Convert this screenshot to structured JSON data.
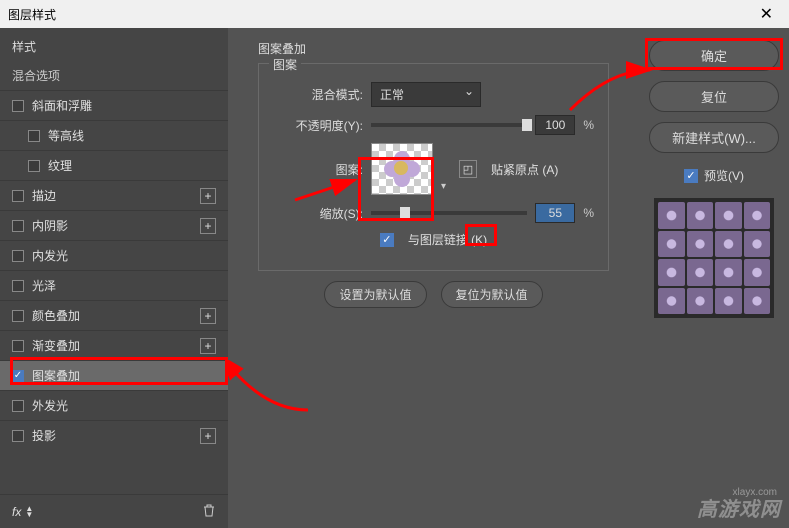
{
  "window": {
    "title": "图层样式",
    "close": "✕"
  },
  "sidebar": {
    "header": "样式",
    "blend_options": "混合选项",
    "items": [
      {
        "label": "斜面和浮雕",
        "checked": false,
        "plus": false,
        "indent": false
      },
      {
        "label": "等高线",
        "checked": false,
        "plus": false,
        "indent": true
      },
      {
        "label": "纹理",
        "checked": false,
        "plus": false,
        "indent": true
      },
      {
        "label": "描边",
        "checked": false,
        "plus": true,
        "indent": false
      },
      {
        "label": "内阴影",
        "checked": false,
        "plus": true,
        "indent": false
      },
      {
        "label": "内发光",
        "checked": false,
        "plus": false,
        "indent": false
      },
      {
        "label": "光泽",
        "checked": false,
        "plus": false,
        "indent": false
      },
      {
        "label": "颜色叠加",
        "checked": false,
        "plus": true,
        "indent": false
      },
      {
        "label": "渐变叠加",
        "checked": false,
        "plus": true,
        "indent": false
      },
      {
        "label": "图案叠加",
        "checked": true,
        "plus": false,
        "indent": false,
        "active": true
      },
      {
        "label": "外发光",
        "checked": false,
        "plus": false,
        "indent": false
      },
      {
        "label": "投影",
        "checked": false,
        "plus": true,
        "indent": false
      }
    ],
    "fx": "fx"
  },
  "panel": {
    "outer_title": "图案叠加",
    "inner_title": "图案",
    "blend_mode_label": "混合模式:",
    "blend_mode_value": "正常",
    "opacity_label": "不透明度(Y):",
    "opacity_value": "100",
    "pattern_label": "图案:",
    "snap_label": "贴紧原点 (A)",
    "scale_label": "缩放(S):",
    "scale_value": "55",
    "link_label": "与图层链接 (K)",
    "set_default": "设置为默认值",
    "reset_default": "复位为默认值",
    "percent": "%"
  },
  "right": {
    "ok": "确定",
    "reset": "复位",
    "new_style": "新建样式(W)...",
    "preview": "预览(V)"
  },
  "watermark": {
    "main": "高游戏网",
    "sub": "xlayx.com"
  }
}
